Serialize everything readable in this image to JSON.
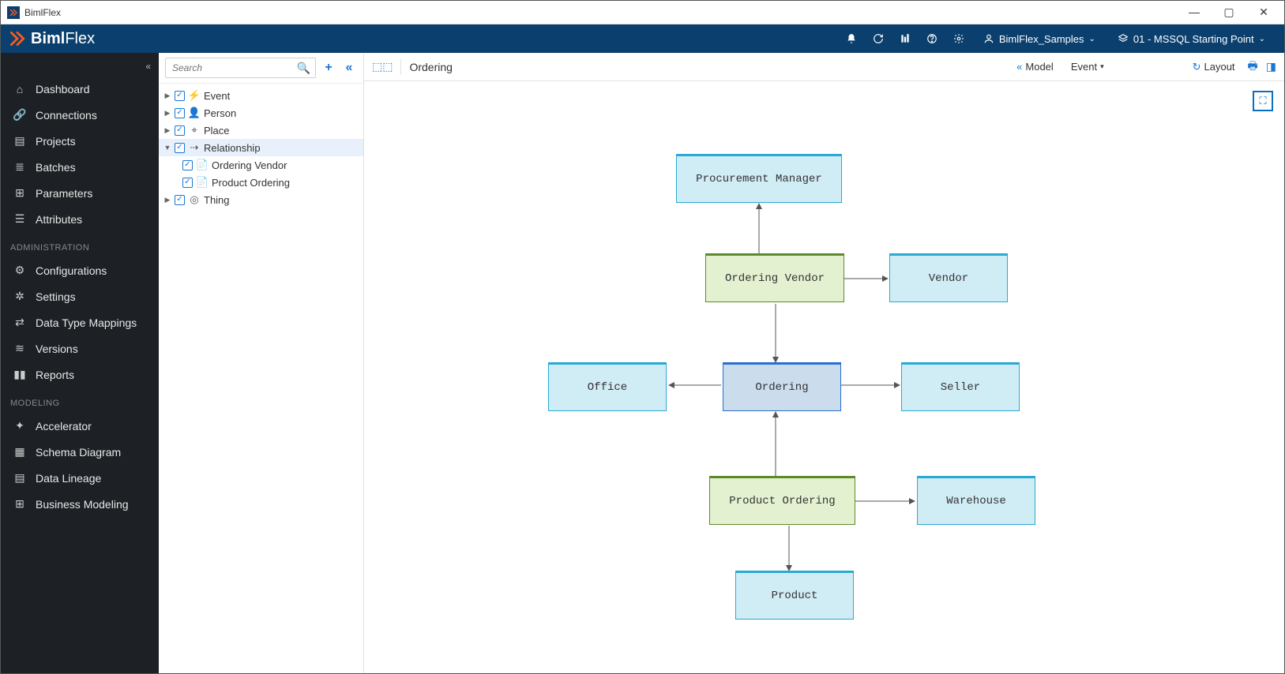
{
  "window": {
    "title": "BimlFlex"
  },
  "brand": {
    "part1": "Biml",
    "part2": "Flex"
  },
  "header": {
    "customer_label": "BimlFlex_Samples",
    "version_label": "01 - MSSQL Starting Point"
  },
  "leftnav": {
    "items": [
      {
        "label": "Dashboard",
        "icon": "home"
      },
      {
        "label": "Connections",
        "icon": "link"
      },
      {
        "label": "Projects",
        "icon": "projects"
      },
      {
        "label": "Batches",
        "icon": "batches"
      },
      {
        "label": "Parameters",
        "icon": "parameters"
      },
      {
        "label": "Attributes",
        "icon": "attributes"
      }
    ],
    "section_admin": "ADMINISTRATION",
    "admin_items": [
      {
        "label": "Configurations",
        "icon": "gear"
      },
      {
        "label": "Settings",
        "icon": "wrench"
      },
      {
        "label": "Data Type Mappings",
        "icon": "mapping"
      },
      {
        "label": "Versions",
        "icon": "versions"
      },
      {
        "label": "Reports",
        "icon": "chart"
      }
    ],
    "section_model": "MODELING",
    "model_items": [
      {
        "label": "Accelerator",
        "icon": "accel"
      },
      {
        "label": "Schema Diagram",
        "icon": "schema"
      },
      {
        "label": "Data Lineage",
        "icon": "lineage"
      },
      {
        "label": "Business Modeling",
        "icon": "biz"
      }
    ]
  },
  "search": {
    "placeholder": "Search"
  },
  "tree": {
    "event": "Event",
    "person": "Person",
    "place": "Place",
    "relationship": "Relationship",
    "ordering_vendor": "Ordering Vendor",
    "product_ordering": "Product Ordering",
    "thing": "Thing"
  },
  "toolbar": {
    "crumb": "Ordering",
    "model": "Model",
    "event": "Event",
    "layout": "Layout"
  },
  "diagram": {
    "nodes": {
      "procurement_manager": "Procurement Manager",
      "ordering_vendor": "Ordering Vendor",
      "vendor": "Vendor",
      "office": "Office",
      "ordering": "Ordering",
      "seller": "Seller",
      "product_ordering": "Product Ordering",
      "warehouse": "Warehouse",
      "product": "Product"
    }
  }
}
